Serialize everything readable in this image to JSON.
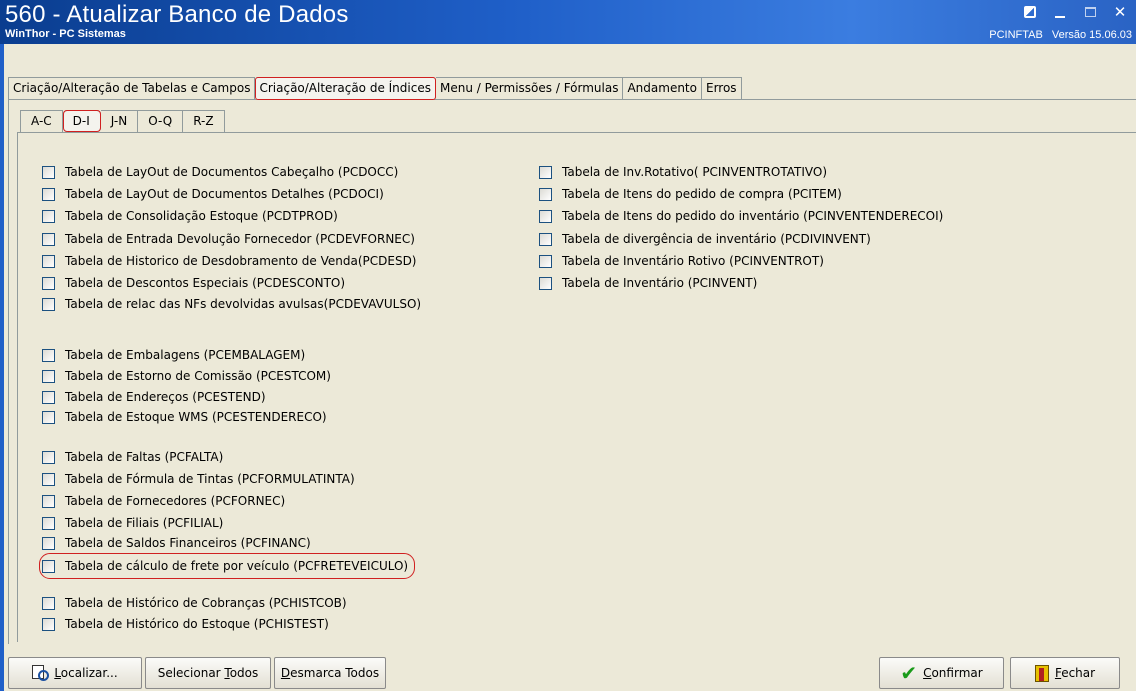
{
  "window": {
    "title": "560 - Atualizar Banco de Dados",
    "subtitle": "WinThor - PC Sistemas",
    "table_name": "PCINFTAB",
    "version": "Versão 15.06.03"
  },
  "tabs": [
    {
      "label": "Criação/Alteração de Tabelas e Campos"
    },
    {
      "label": "Criação/Alteração de Índices"
    },
    {
      "label": "Menu / Permissões / Fórmulas"
    },
    {
      "label": "Andamento"
    },
    {
      "label": "Erros"
    }
  ],
  "subtabs": [
    {
      "label": "A-C"
    },
    {
      "label": "D-I"
    },
    {
      "label": "J-N"
    },
    {
      "label": "O-Q"
    },
    {
      "label": "R-Z"
    }
  ],
  "left_items": [
    "Tabela de LayOut de Documentos Cabeçalho (PCDOCC)",
    "Tabela de LayOut de Documentos Detalhes (PCDOCI)",
    "Tabela de Consolidação Estoque (PCDTPROD)",
    "Tabela de Entrada Devolução Fornecedor (PCDEVFORNEC)",
    "Tabela de Historico de Desdobramento de Venda(PCDESD)",
    "Tabela de Descontos Especiais (PCDESCONTO)",
    "Tabela de relac das NFs devolvidas avulsas(PCDEVAVULSO)",
    "Tabela de Embalagens (PCEMBALAGEM)",
    "Tabela de Estorno de Comissão (PCESTCOM)",
    "Tabela de Endereços (PCESTEND)",
    "Tabela de Estoque WMS (PCESTENDERECO)",
    "Tabela de Faltas (PCFALTA)",
    "Tabela de Fórmula de Tintas (PCFORMULATINTA)",
    "Tabela de Fornecedores (PCFORNEC)",
    "Tabela de Filiais (PCFILIAL)",
    "Tabela de Saldos Financeiros (PCFINANC)",
    "Tabela de cálculo de frete por veículo (PCFRETEVEICULO)",
    "Tabela de Histórico de Cobranças (PCHISTCOB)",
    "Tabela de Histórico do Estoque (PCHISTEST)"
  ],
  "right_items": [
    "Tabela de Inv.Rotativo( PCINVENTROTATIVO)",
    "Tabela de Itens do pedido de compra (PCITEM)",
    "Tabela de Itens do pedido do inventário (PCINVENTENDERECOI)",
    "Tabela de divergência de inventário (PCDIVINVENT)",
    "Tabela de Inventário Rotivo (PCINVENTROT)",
    "Tabela de Inventário (PCINVENT)"
  ],
  "buttons": {
    "localizar": "ocalizar...",
    "localizar_key": "L",
    "selecionar_prefix": "Selecionar ",
    "selecionar_key": "T",
    "selecionar_suffix": "odos",
    "desmarca_key": "D",
    "desmarca_suffix": "esmarca Todos",
    "confirmar_key": "C",
    "confirmar_suffix": "onfirmar",
    "fechar_key": "F",
    "fechar_suffix": "echar"
  },
  "colors": {
    "title_bar": "#1f5fc8",
    "panel": "#ece9d8",
    "highlight_circle": "#d02020"
  }
}
